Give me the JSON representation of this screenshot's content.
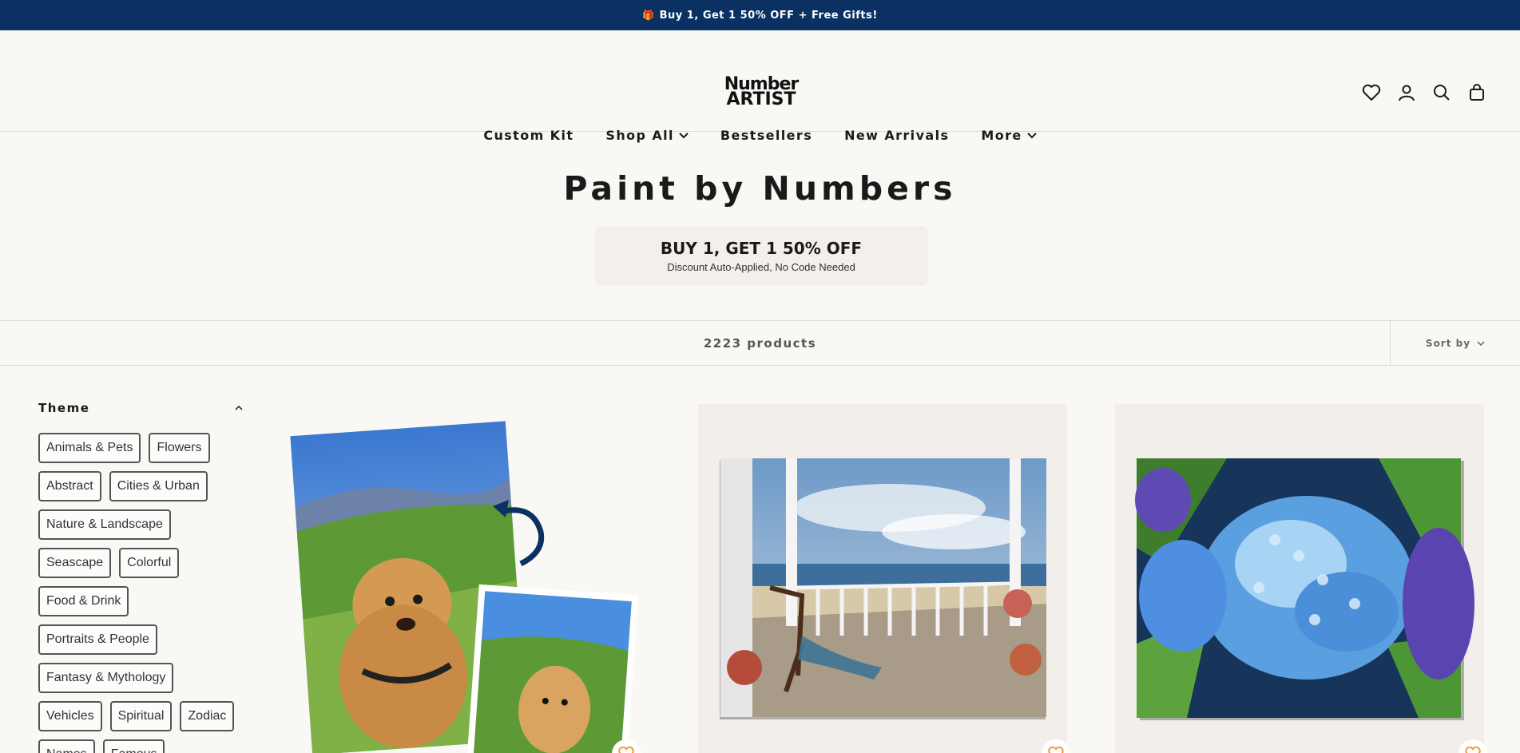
{
  "announcement": "Buy 1, Get 1 50% OFF + Free Gifts!",
  "logo": {
    "line1": "Number",
    "line2": "ARTIST"
  },
  "nav": [
    "Custom Kit",
    "Shop All",
    "Bestsellers",
    "New Arrivals",
    "More"
  ],
  "page_title": "Paint by Numbers",
  "promo": {
    "headline": "BUY 1, GET 1 50% OFF",
    "subtext": "Discount Auto-Applied, No Code Needed"
  },
  "toolbar": {
    "count": "2223 products",
    "sort_label": "Sort by"
  },
  "filter": {
    "title": "Theme",
    "chips": [
      "Animals & Pets",
      "Flowers",
      "Abstract",
      "Cities & Urban",
      "Nature & Landscape",
      "Seascape",
      "Colorful",
      "Food & Drink",
      "Portraits & People",
      "Fantasy & Mythology",
      "Vehicles",
      "Spiritual",
      "Zodiac",
      "Names",
      "Famous"
    ]
  },
  "colors": {
    "accent": "#f29a2e",
    "announce_bg": "#0b3163"
  }
}
